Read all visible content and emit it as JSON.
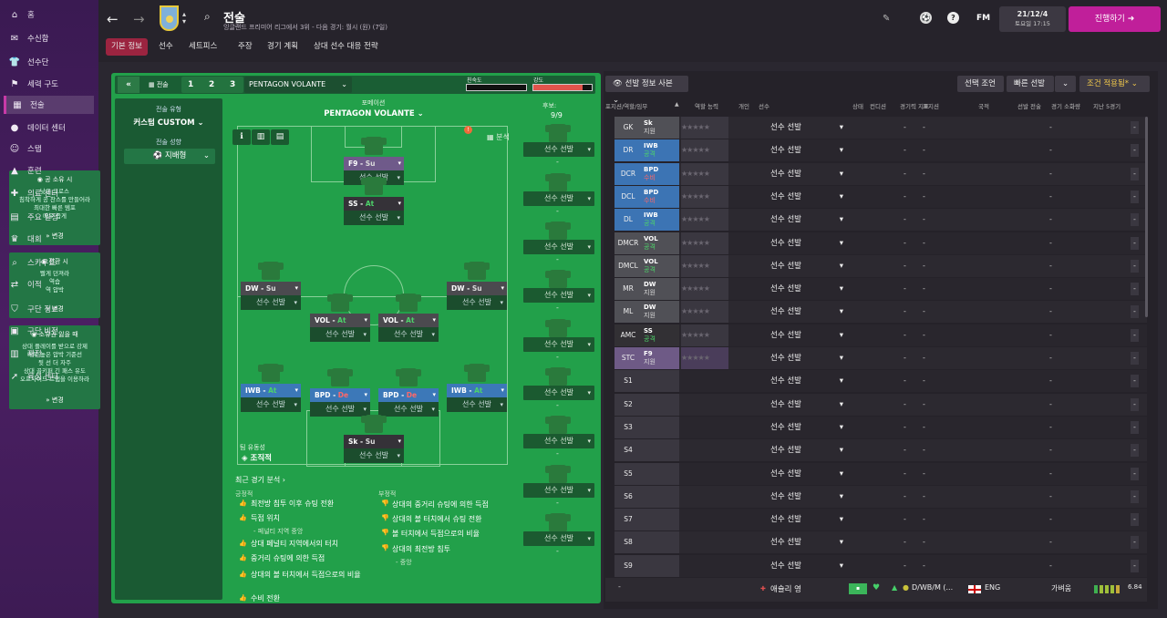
{
  "sidebar": {
    "items": [
      {
        "label": "홈",
        "icon": "home-icon",
        "glyph": "⌂"
      },
      {
        "label": "수신함",
        "icon": "inbox-icon",
        "glyph": "✉"
      },
      {
        "label": "선수단",
        "icon": "squad-shirt-icon",
        "glyph": "👕"
      },
      {
        "label": "세력 구도",
        "icon": "dynamics-icon",
        "glyph": "⚑"
      },
      {
        "label": "전술",
        "icon": "tactics-icon",
        "glyph": "▦"
      },
      {
        "label": "데이터 센터",
        "icon": "data-center-icon",
        "glyph": "●"
      },
      {
        "label": "스탭",
        "icon": "staff-icon",
        "glyph": "☺"
      },
      {
        "label": "훈련",
        "icon": "training-icon",
        "glyph": "▲"
      },
      {
        "label": "의료 센터",
        "icon": "medical-icon",
        "glyph": "✚"
      },
      {
        "label": "주요 일정",
        "icon": "calendar-icon",
        "glyph": "▤"
      },
      {
        "label": "대회",
        "icon": "trophy-icon",
        "glyph": "♛"
      },
      {
        "label": "스카우트",
        "icon": "scout-icon",
        "glyph": "⌕"
      },
      {
        "label": "이적",
        "icon": "transfer-icon",
        "glyph": "⇄"
      },
      {
        "label": "구단 정보",
        "icon": "club-info-icon",
        "glyph": "⛉"
      },
      {
        "label": "구단 비전",
        "icon": "club-vision-icon",
        "glyph": "▣"
      },
      {
        "label": "재정",
        "icon": "finance-icon",
        "glyph": "▥"
      },
      {
        "label": "육성 센터",
        "icon": "development-icon",
        "glyph": "➚"
      }
    ],
    "active_index": 4
  },
  "header": {
    "title": "전술",
    "subtitle": "잉글랜드 프리미어 리그에서 3위 - 다음 경기: 월시 (원) (7일)",
    "date": "21/12/4",
    "day_time": "토요일 17:15",
    "continue_label": "진행하기",
    "fm_label": "FM",
    "crest_text": "AVFC"
  },
  "tabs": [
    "기본 정보",
    "선수",
    "세트피스",
    "주장",
    "경기 계획",
    "상대 선수 대응 전략"
  ],
  "tactics_bar": {
    "label": "전술",
    "slots": [
      "1",
      "2",
      "3"
    ],
    "formation_select": "PENTAGON VOLANTE",
    "familiarity_label": "친숙도",
    "intensity_label": "강도",
    "familiarity_pct": 0.95,
    "intensity_pct": 0.85
  },
  "left_col": {
    "style_label": "전술 유형",
    "style_value": "커스텀 CUSTOM",
    "mentality_label": "전술 성향",
    "mentality_value": "지배형",
    "in_possession": {
      "title": "공 소유 시",
      "lines": [
        "낮은 크로스",
        "침착하게 공 찬스를 만들어라",
        "최대한 빠른 템포",
        "매우 좁게"
      ],
      "edit": "변경"
    },
    "transition": {
      "title": "전환 시",
      "lines": [
        "빨게 던져라",
        "역습",
        "역 압박"
      ],
      "edit": "변경"
    },
    "out_possession": {
      "title": "소유권 잃을 때",
      "lines": [
        "상대 플레이를 받으로 강제",
        "매우 높은 압박 기준선",
        "뒷 선 더 자주",
        "상대 골키퍼 긴 패스 유도",
        "오프사이드 트랩을 이용하라"
      ],
      "edit": "변경"
    }
  },
  "pitch": {
    "formation_label": "포메이션",
    "formation": "PENTAGON VOLANTE",
    "team_fluidity_label": "팀 유동성",
    "team_fluidity": "조직적",
    "analysis_label": "분석",
    "subs_label": "후보:",
    "subs_count": "9/9",
    "slot_placeholder": "선수 선발",
    "players": [
      {
        "role": "F9",
        "duty": "Su",
        "cls": "purple",
        "dcls": "su"
      },
      {
        "role": "SS",
        "duty": "At",
        "cls": "dark",
        "dcls": "at"
      },
      {
        "role": "DW",
        "duty": "Su",
        "cls": "grey",
        "dcls": "su"
      },
      {
        "role": "DW",
        "duty": "Su",
        "cls": "grey",
        "dcls": "su"
      },
      {
        "role": "VOL",
        "duty": "At",
        "cls": "grey",
        "dcls": "at"
      },
      {
        "role": "VOL",
        "duty": "At",
        "cls": "grey",
        "dcls": "at"
      },
      {
        "role": "IWB",
        "duty": "At",
        "cls": "blue",
        "dcls": "at"
      },
      {
        "role": "BPD",
        "duty": "De",
        "cls": "blue",
        "dcls": "de"
      },
      {
        "role": "BPD",
        "duty": "De",
        "cls": "blue",
        "dcls": "de"
      },
      {
        "role": "IWB",
        "duty": "At",
        "cls": "blue",
        "dcls": "at"
      },
      {
        "role": "Sk",
        "duty": "Su",
        "cls": "dark",
        "dcls": "su"
      }
    ],
    "subs_dash": "-"
  },
  "analysis": {
    "title": "최근 경기 분석",
    "positive_label": "긍정적",
    "negative_label": "부정적",
    "positives": [
      "최전방 침투 이후 슈팅 전환",
      "득점 위치",
      "- 페널티 지역 중앙",
      "상대 페널티 지역에서의 터치",
      "중거리 슈팅에 의한 득점",
      "상대의 볼 터치에서 득점으로의 비율",
      "수비 전환"
    ],
    "negatives": [
      "상대의 중거리 슈팅에 의한 득점",
      "상대의 볼 터치에서 슈팅 전환",
      "볼 터치에서 득점으로의 비율",
      "상대의 최전방 침투",
      "- 중앙"
    ]
  },
  "table": {
    "view_select": "선발 정보 사본",
    "advice_btn": "선택 조언",
    "quick_pick": "빠른 선발",
    "condition_btn": "조건 적용됨*",
    "headers": [
      "포지션/역할/임무",
      "역할 능력",
      "개인",
      "선수",
      "상태",
      "컨디션",
      "경기력 지표",
      "포지션",
      "국적",
      "선발 전술",
      "경기 소화량",
      "지난 5경기"
    ],
    "rows": [
      {
        "pos": "GK",
        "role": "Sk",
        "duty": "지원",
        "cls": "gp",
        "dc": "su"
      },
      {
        "pos": "DR",
        "role": "IWB",
        "duty": "공격",
        "cls": "bp",
        "dc": "at"
      },
      {
        "pos": "DCR",
        "role": "BPD",
        "duty": "수비",
        "cls": "bp",
        "dc": "de"
      },
      {
        "pos": "DCL",
        "role": "BPD",
        "duty": "수비",
        "cls": "bp",
        "dc": "de"
      },
      {
        "pos": "DL",
        "role": "IWB",
        "duty": "공격",
        "cls": "bp",
        "dc": "at"
      },
      {
        "pos": "DMCR",
        "role": "VOL",
        "duty": "공격",
        "cls": "gp",
        "dc": "at"
      },
      {
        "pos": "DMCL",
        "role": "VOL",
        "duty": "공격",
        "cls": "gp",
        "dc": "at"
      },
      {
        "pos": "MR",
        "role": "DW",
        "duty": "지원",
        "cls": "gp",
        "dc": "su"
      },
      {
        "pos": "ML",
        "role": "DW",
        "duty": "지원",
        "cls": "gp",
        "dc": "su"
      },
      {
        "pos": "AMC",
        "role": "SS",
        "duty": "공격",
        "cls": "dk",
        "dc": "at"
      },
      {
        "pos": "STC",
        "role": "F9",
        "duty": "지원",
        "cls": "pp",
        "dc": "su"
      },
      {
        "pos": "S1"
      },
      {
        "pos": "S2"
      },
      {
        "pos": "S3"
      },
      {
        "pos": "S4"
      },
      {
        "pos": "S5"
      },
      {
        "pos": "S6"
      },
      {
        "pos": "S7"
      },
      {
        "pos": "S8"
      },
      {
        "pos": "S9"
      }
    ],
    "select_label": "선수 선발",
    "dash": "-",
    "bottom_row": {
      "pos": "-",
      "name": "애슐리 영",
      "position": "D/WB/M (...",
      "nation": "ENG",
      "status": "가벼움",
      "rating": "6.84"
    }
  }
}
